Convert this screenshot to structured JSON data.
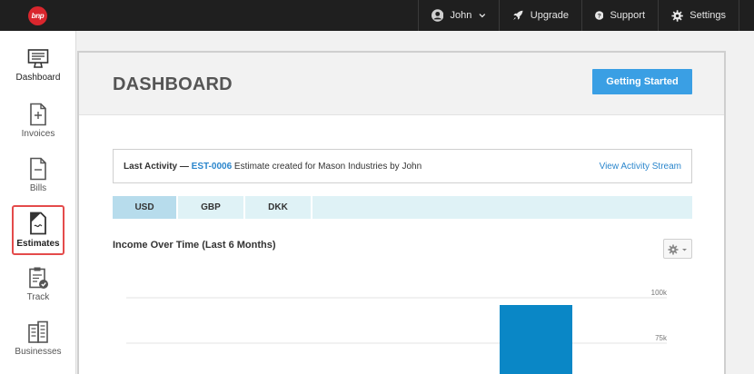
{
  "topbar": {
    "logo_text": "bnp",
    "user_name": "John",
    "upgrade_label": "Upgrade",
    "support_label": "Support",
    "settings_label": "Settings"
  },
  "sidebar": {
    "items": [
      {
        "label": "Dashboard",
        "icon": "monitor-icon"
      },
      {
        "label": "Invoices",
        "icon": "invoice-icon"
      },
      {
        "label": "Bills",
        "icon": "bill-icon"
      },
      {
        "label": "Estimates",
        "icon": "estimate-icon",
        "active": true
      },
      {
        "label": "Track",
        "icon": "clipboard-check-icon"
      },
      {
        "label": "Businesses",
        "icon": "building-icon"
      }
    ]
  },
  "main": {
    "title": "DASHBOARD",
    "getting_started_label": "Getting Started",
    "activity": {
      "prefix": "Last Activity —",
      "link": "EST-0006",
      "text": "Estimate created for Mason Industries by John",
      "view_label": "View Activity Stream"
    },
    "currency_tabs": [
      "USD",
      "GBP",
      "DKK"
    ],
    "selected_currency": "USD",
    "chart_title": "Income Over Time (Last 6 Months)"
  },
  "chart_data": {
    "type": "bar",
    "title": "Income Over Time (Last 6 Months)",
    "y_ticks": [
      "100k",
      "75k"
    ],
    "ylim_visible": [
      75000,
      100000
    ],
    "bar_color": "#0a87c6",
    "values": [
      null,
      null,
      null,
      null,
      null,
      96000
    ]
  },
  "colors": {
    "accent": "#3a9fe4",
    "link": "#2b86cc",
    "active_border": "#e44b4b",
    "tab_active": "#b7dcec"
  }
}
